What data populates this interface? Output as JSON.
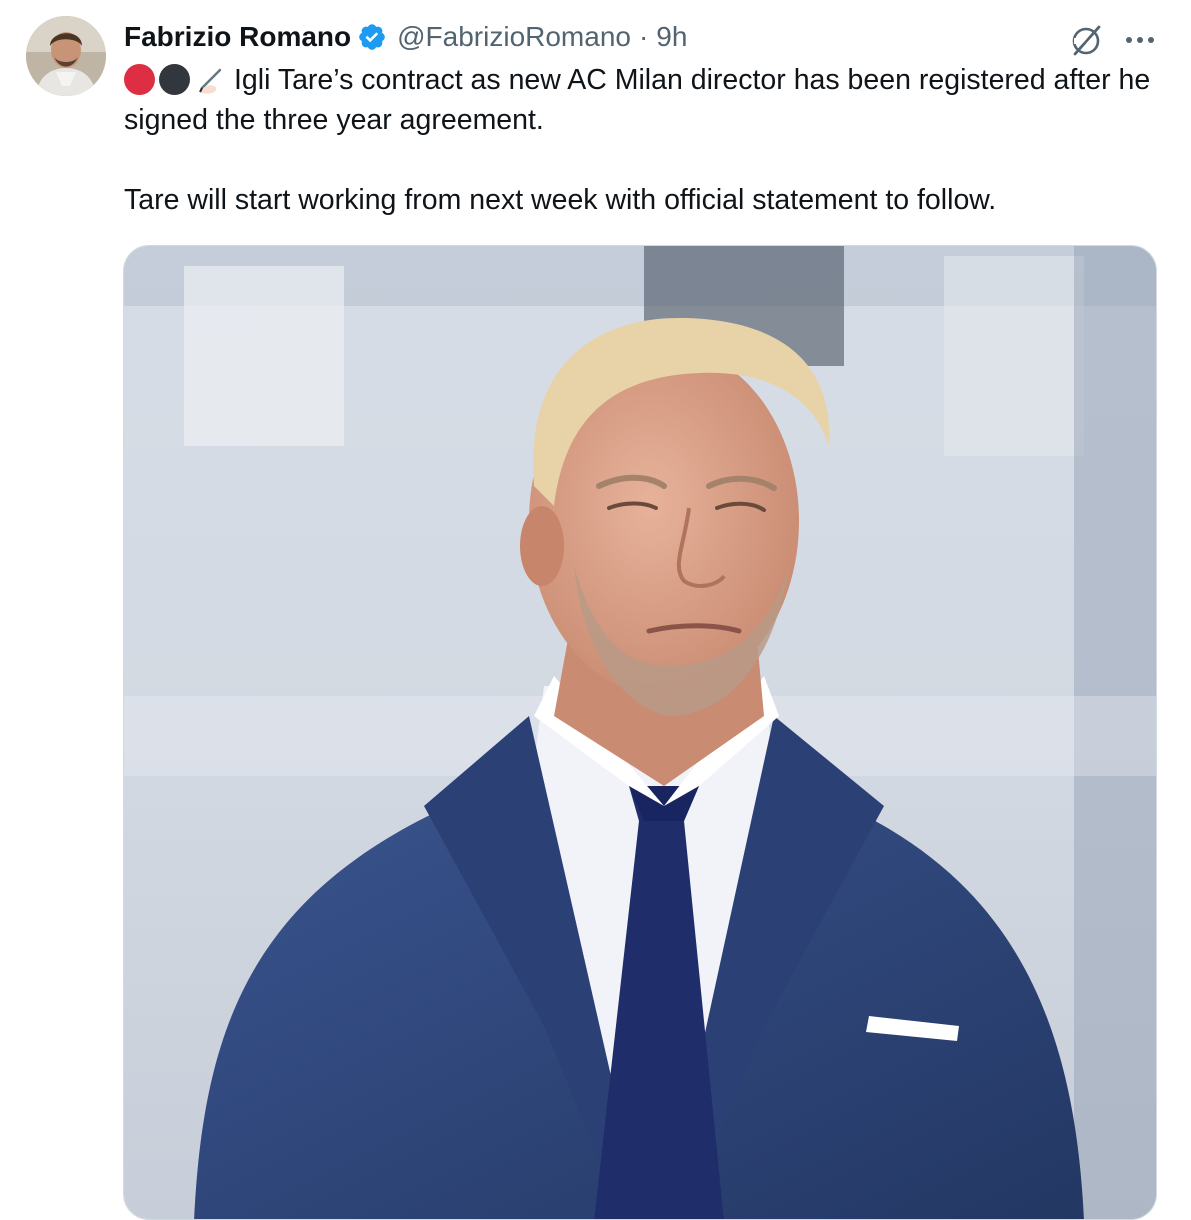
{
  "author": {
    "display_name": "Fabrizio Romano",
    "handle": "@FabrizioRomano",
    "separator": "·",
    "time": "9h",
    "verified_color": "#1d9bf0"
  },
  "icons": {
    "verified": "verified-badge-icon",
    "grok": "grok-icon",
    "more": "more-icon",
    "emoji": [
      "red-circle-emoji",
      "black-circle-emoji",
      "writing-hand-emoji"
    ]
  },
  "tweet": {
    "line1": "Igli Tare’s contract as new AC Milan director has been registered after he signed the three year agreement.",
    "line2": "Tare will start working from next week with official statement to follow."
  },
  "colors": {
    "text": "#0f1419",
    "secondary": "#536471",
    "border": "#cfd9de",
    "suit": "#2c4475"
  }
}
